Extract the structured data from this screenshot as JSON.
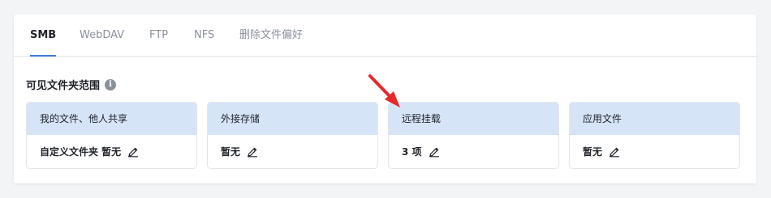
{
  "tabs": [
    {
      "label": "SMB",
      "active": true
    },
    {
      "label": "WebDAV",
      "active": false
    },
    {
      "label": "FTP",
      "active": false
    },
    {
      "label": "NFS",
      "active": false
    },
    {
      "label": "删除文件偏好",
      "active": false
    }
  ],
  "section": {
    "title": "可见文件夹范围",
    "info_icon": "info-icon"
  },
  "cards": [
    {
      "title": "我的文件、他人共享",
      "value": "自定义文件夹 暂无",
      "icon": "pencil-edit-icon"
    },
    {
      "title": "外接存储",
      "value": "暂无",
      "icon": "pencil-edit-icon"
    },
    {
      "title": "远程挂载",
      "value": "3 项",
      "icon": "pencil-edit-icon"
    },
    {
      "title": "应用文件",
      "value": "暂无",
      "icon": "pencil-edit-icon"
    }
  ],
  "annotation": {
    "arrow_color": "#e8282b"
  },
  "colors": {
    "accent": "#3b7bd4",
    "card_header": "#d6e4f7"
  }
}
